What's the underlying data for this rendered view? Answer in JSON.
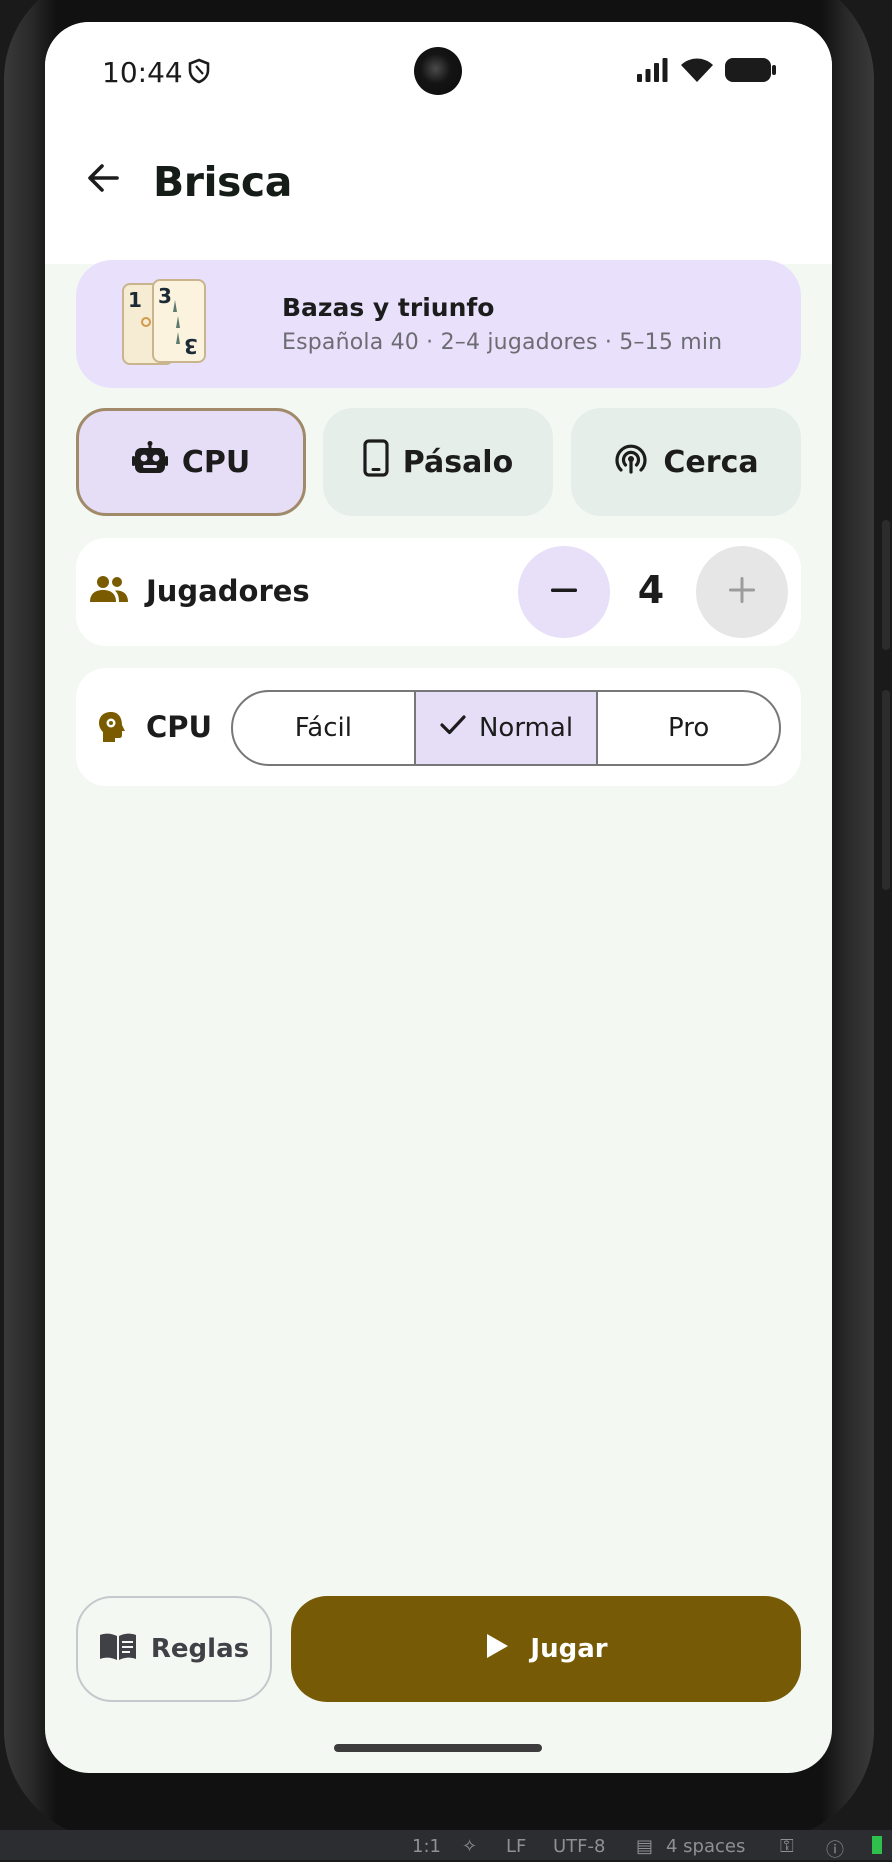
{
  "status_bar": {
    "time": "10:44",
    "icons": [
      "shield-icon",
      "signal-icon",
      "wifi-icon",
      "battery-icon"
    ]
  },
  "app_bar": {
    "title": "Brisca",
    "back_icon": "arrow-left-icon"
  },
  "game_info": {
    "title": "Bazas y triunfo",
    "subtitle": "Española 40 · 2–4 jugadores · 5–15 min",
    "card_ranks": [
      "1",
      "3"
    ]
  },
  "modes": [
    {
      "label": "CPU",
      "icon": "robot-icon",
      "selected": true
    },
    {
      "label": "Pásalo",
      "icon": "smartphone-icon",
      "selected": false
    },
    {
      "label": "Cerca",
      "icon": "nearby-icon",
      "selected": false
    }
  ],
  "players": {
    "label": "Jugadores",
    "count": "4",
    "icon": "group-icon"
  },
  "cpu_difficulty": {
    "label": "CPU",
    "icon": "psychology-icon",
    "options": [
      "Fácil",
      "Normal",
      "Pro"
    ],
    "selected": "Normal"
  },
  "actions": {
    "rules_label": "Reglas",
    "play_label": "Jugar"
  },
  "ide_status": {
    "position": "1:1",
    "line_ending": "LF",
    "encoding": "UTF-8",
    "indent": "4 spaces"
  },
  "colors": {
    "primary": "#775a05",
    "selected_container": "#e6ddf6",
    "info_card": "#e9e1fb",
    "background": "#f3f8f3",
    "icon_accent": "#7a5b00"
  }
}
